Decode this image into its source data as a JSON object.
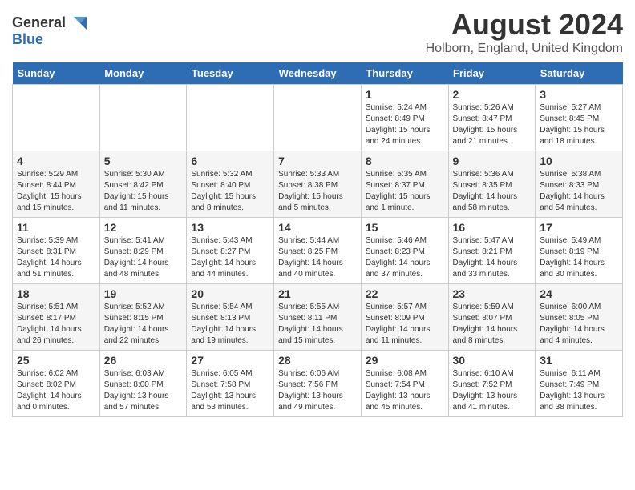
{
  "header": {
    "logo_general": "General",
    "logo_blue": "Blue",
    "month_year": "August 2024",
    "location": "Holborn, England, United Kingdom"
  },
  "days_of_week": [
    "Sunday",
    "Monday",
    "Tuesday",
    "Wednesday",
    "Thursday",
    "Friday",
    "Saturday"
  ],
  "weeks": [
    [
      {
        "day": "",
        "info": ""
      },
      {
        "day": "",
        "info": ""
      },
      {
        "day": "",
        "info": ""
      },
      {
        "day": "",
        "info": ""
      },
      {
        "day": "1",
        "info": "Sunrise: 5:24 AM\nSunset: 8:49 PM\nDaylight: 15 hours\nand 24 minutes."
      },
      {
        "day": "2",
        "info": "Sunrise: 5:26 AM\nSunset: 8:47 PM\nDaylight: 15 hours\nand 21 minutes."
      },
      {
        "day": "3",
        "info": "Sunrise: 5:27 AM\nSunset: 8:45 PM\nDaylight: 15 hours\nand 18 minutes."
      }
    ],
    [
      {
        "day": "4",
        "info": "Sunrise: 5:29 AM\nSunset: 8:44 PM\nDaylight: 15 hours\nand 15 minutes."
      },
      {
        "day": "5",
        "info": "Sunrise: 5:30 AM\nSunset: 8:42 PM\nDaylight: 15 hours\nand 11 minutes."
      },
      {
        "day": "6",
        "info": "Sunrise: 5:32 AM\nSunset: 8:40 PM\nDaylight: 15 hours\nand 8 minutes."
      },
      {
        "day": "7",
        "info": "Sunrise: 5:33 AM\nSunset: 8:38 PM\nDaylight: 15 hours\nand 5 minutes."
      },
      {
        "day": "8",
        "info": "Sunrise: 5:35 AM\nSunset: 8:37 PM\nDaylight: 15 hours\nand 1 minute."
      },
      {
        "day": "9",
        "info": "Sunrise: 5:36 AM\nSunset: 8:35 PM\nDaylight: 14 hours\nand 58 minutes."
      },
      {
        "day": "10",
        "info": "Sunrise: 5:38 AM\nSunset: 8:33 PM\nDaylight: 14 hours\nand 54 minutes."
      }
    ],
    [
      {
        "day": "11",
        "info": "Sunrise: 5:39 AM\nSunset: 8:31 PM\nDaylight: 14 hours\nand 51 minutes."
      },
      {
        "day": "12",
        "info": "Sunrise: 5:41 AM\nSunset: 8:29 PM\nDaylight: 14 hours\nand 48 minutes."
      },
      {
        "day": "13",
        "info": "Sunrise: 5:43 AM\nSunset: 8:27 PM\nDaylight: 14 hours\nand 44 minutes."
      },
      {
        "day": "14",
        "info": "Sunrise: 5:44 AM\nSunset: 8:25 PM\nDaylight: 14 hours\nand 40 minutes."
      },
      {
        "day": "15",
        "info": "Sunrise: 5:46 AM\nSunset: 8:23 PM\nDaylight: 14 hours\nand 37 minutes."
      },
      {
        "day": "16",
        "info": "Sunrise: 5:47 AM\nSunset: 8:21 PM\nDaylight: 14 hours\nand 33 minutes."
      },
      {
        "day": "17",
        "info": "Sunrise: 5:49 AM\nSunset: 8:19 PM\nDaylight: 14 hours\nand 30 minutes."
      }
    ],
    [
      {
        "day": "18",
        "info": "Sunrise: 5:51 AM\nSunset: 8:17 PM\nDaylight: 14 hours\nand 26 minutes."
      },
      {
        "day": "19",
        "info": "Sunrise: 5:52 AM\nSunset: 8:15 PM\nDaylight: 14 hours\nand 22 minutes."
      },
      {
        "day": "20",
        "info": "Sunrise: 5:54 AM\nSunset: 8:13 PM\nDaylight: 14 hours\nand 19 minutes."
      },
      {
        "day": "21",
        "info": "Sunrise: 5:55 AM\nSunset: 8:11 PM\nDaylight: 14 hours\nand 15 minutes."
      },
      {
        "day": "22",
        "info": "Sunrise: 5:57 AM\nSunset: 8:09 PM\nDaylight: 14 hours\nand 11 minutes."
      },
      {
        "day": "23",
        "info": "Sunrise: 5:59 AM\nSunset: 8:07 PM\nDaylight: 14 hours\nand 8 minutes."
      },
      {
        "day": "24",
        "info": "Sunrise: 6:00 AM\nSunset: 8:05 PM\nDaylight: 14 hours\nand 4 minutes."
      }
    ],
    [
      {
        "day": "25",
        "info": "Sunrise: 6:02 AM\nSunset: 8:02 PM\nDaylight: 14 hours\nand 0 minutes."
      },
      {
        "day": "26",
        "info": "Sunrise: 6:03 AM\nSunset: 8:00 PM\nDaylight: 13 hours\nand 57 minutes."
      },
      {
        "day": "27",
        "info": "Sunrise: 6:05 AM\nSunset: 7:58 PM\nDaylight: 13 hours\nand 53 minutes."
      },
      {
        "day": "28",
        "info": "Sunrise: 6:06 AM\nSunset: 7:56 PM\nDaylight: 13 hours\nand 49 minutes."
      },
      {
        "day": "29",
        "info": "Sunrise: 6:08 AM\nSunset: 7:54 PM\nDaylight: 13 hours\nand 45 minutes."
      },
      {
        "day": "30",
        "info": "Sunrise: 6:10 AM\nSunset: 7:52 PM\nDaylight: 13 hours\nand 41 minutes."
      },
      {
        "day": "31",
        "info": "Sunrise: 6:11 AM\nSunset: 7:49 PM\nDaylight: 13 hours\nand 38 minutes."
      }
    ]
  ]
}
